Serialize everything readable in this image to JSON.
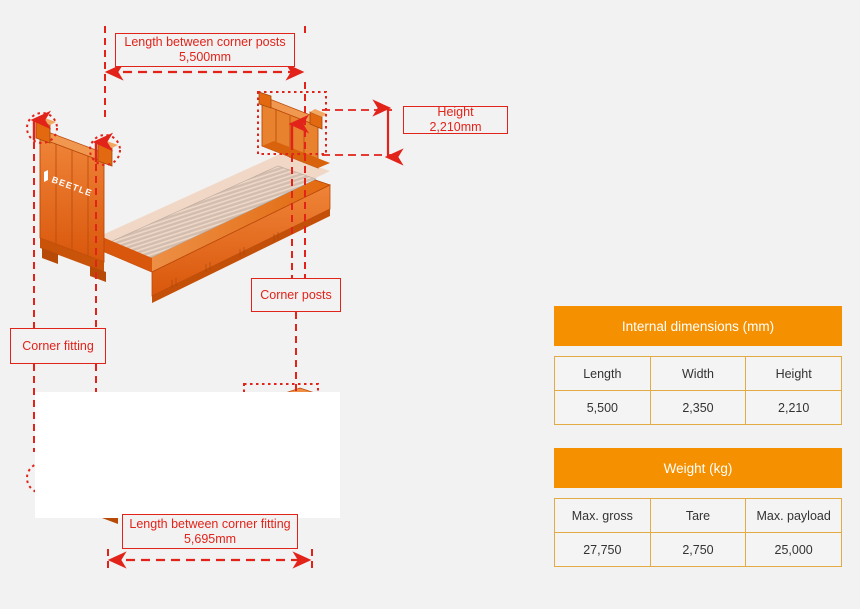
{
  "diagram": {
    "title": "Flat rack container dimension diagram",
    "brand_text": "BEETLE",
    "accent_red": "#e2231a",
    "container_orange": "#e2600f",
    "background": "#f2f2f2"
  },
  "annotations": [
    {
      "id": "length-between-corner-posts",
      "text": "Length between corner posts\n5,500mm",
      "label": "Length between corner posts",
      "value": "5,500mm"
    },
    {
      "id": "height",
      "text": "Height 2,210mm",
      "label": "Height",
      "value": "2,210mm"
    },
    {
      "id": "corner-posts",
      "text": "Corner posts",
      "label": "Corner posts",
      "value": ""
    },
    {
      "id": "corner-fitting",
      "text": "Corner fitting",
      "label": "Corner fitting",
      "value": ""
    },
    {
      "id": "length-between-corner-fitting",
      "text": "Length between corner fitting\n5,695mm",
      "label": "Length between corner fitting",
      "value": "5,695mm"
    }
  ],
  "tables": {
    "internal_dimensions": {
      "header": "Internal dimensions (mm)",
      "columns": [
        "Length",
        "Width",
        "Height"
      ],
      "values": [
        "5,500",
        "2,350",
        "2,210"
      ]
    },
    "weight": {
      "header": "Weight (kg)",
      "columns": [
        "Max. gross",
        "Tare",
        "Max. payload"
      ],
      "values": [
        "27,750",
        "2,750",
        "25,000"
      ]
    }
  }
}
